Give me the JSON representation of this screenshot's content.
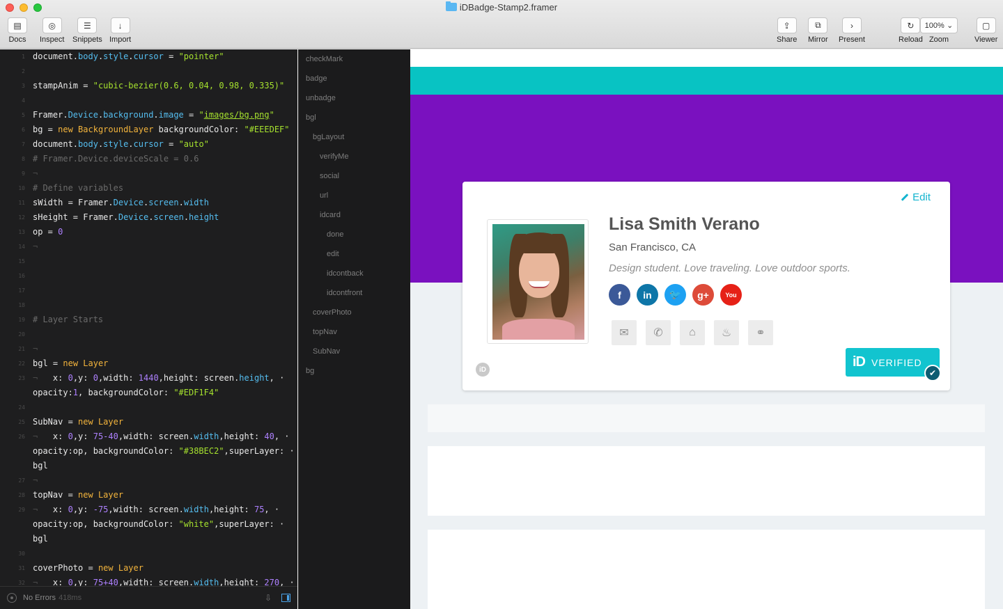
{
  "window": {
    "title": "iDBadge-Stamp2.framer"
  },
  "toolbar": {
    "left": [
      {
        "label": "Docs",
        "icon": "docs-icon",
        "glyph": "▤"
      },
      {
        "label": "Inspect",
        "icon": "inspect-icon",
        "glyph": "◎"
      },
      {
        "label": "Snippets",
        "icon": "snippets-icon",
        "glyph": "☰"
      },
      {
        "label": "Import",
        "icon": "import-icon",
        "glyph": "↓"
      }
    ],
    "right": [
      {
        "label": "Share",
        "icon": "share-icon",
        "glyph": "⇪"
      },
      {
        "label": "Mirror",
        "icon": "mirror-icon",
        "glyph": "⧉"
      },
      {
        "label": "Present",
        "icon": "present-icon",
        "glyph": "›"
      },
      {
        "label": "Reload",
        "icon": "reload-icon",
        "glyph": "↻"
      },
      {
        "label": "Zoom",
        "icon": "zoom-icon",
        "glyph": ""
      },
      {
        "label": "Viewer",
        "icon": "viewer-icon",
        "glyph": "▢"
      }
    ],
    "zoom_value": "100%"
  },
  "code": [
    {
      "n": "1",
      "tokens": [
        [
          "document.",
          ""
        ],
        [
          "body",
          "prop"
        ],
        [
          ".",
          ""
        ],
        [
          "style",
          "prop"
        ],
        [
          ".",
          ""
        ],
        [
          "cursor",
          "prop"
        ],
        [
          " = ",
          ""
        ],
        [
          "\"pointer\"",
          "str"
        ]
      ]
    },
    {
      "n": "2",
      "tokens": []
    },
    {
      "n": "3",
      "tokens": [
        [
          "stampAnim",
          ""
        ],
        [
          " = ",
          ""
        ],
        [
          "\"cubic-bezier(0.6, 0.04, 0.98, 0.335)\"",
          "str"
        ]
      ]
    },
    {
      "n": "4",
      "tokens": []
    },
    {
      "n": "5",
      "tokens": [
        [
          "Framer.",
          ""
        ],
        [
          "Device",
          "prop"
        ],
        [
          ".",
          ""
        ],
        [
          "background",
          "prop"
        ],
        [
          ".",
          ""
        ],
        [
          "image",
          "prop"
        ],
        [
          " = ",
          ""
        ],
        [
          "\"",
          "str"
        ],
        [
          "images/bg.png",
          "strlink"
        ],
        [
          "\"",
          "str"
        ]
      ]
    },
    {
      "n": "6",
      "tokens": [
        [
          "bg",
          ""
        ],
        [
          " = ",
          ""
        ],
        [
          "new ",
          "kw"
        ],
        [
          "BackgroundLayer",
          "kw"
        ],
        [
          " backgroundColor: ",
          ""
        ],
        [
          "\"#EEEDEF\"",
          "str"
        ]
      ]
    },
    {
      "n": "7",
      "tokens": [
        [
          "document.",
          ""
        ],
        [
          "body",
          "prop"
        ],
        [
          ".",
          ""
        ],
        [
          "style",
          "prop"
        ],
        [
          ".",
          ""
        ],
        [
          "cursor",
          "prop"
        ],
        [
          " = ",
          ""
        ],
        [
          "\"auto\"",
          "str"
        ]
      ]
    },
    {
      "n": "8",
      "tokens": [
        [
          "# Framer.Device.deviceScale = 0.6",
          "comment"
        ]
      ]
    },
    {
      "n": "9",
      "tokens": [
        [
          "¬",
          "dot"
        ]
      ]
    },
    {
      "n": "10",
      "tokens": [
        [
          "# Define variables",
          "comment"
        ]
      ]
    },
    {
      "n": "11",
      "tokens": [
        [
          "sWidth",
          ""
        ],
        [
          " = ",
          ""
        ],
        [
          "Framer",
          ""
        ],
        [
          ".",
          ""
        ],
        [
          "Device",
          "prop"
        ],
        [
          ".",
          ""
        ],
        [
          "screen",
          "prop"
        ],
        [
          ".",
          ""
        ],
        [
          "width",
          "prop"
        ]
      ]
    },
    {
      "n": "12",
      "tokens": [
        [
          "sHeight",
          ""
        ],
        [
          " = ",
          ""
        ],
        [
          "Framer",
          ""
        ],
        [
          ".",
          ""
        ],
        [
          "Device",
          "prop"
        ],
        [
          ".",
          ""
        ],
        [
          "screen",
          "prop"
        ],
        [
          ".",
          ""
        ],
        [
          "height",
          "prop"
        ]
      ]
    },
    {
      "n": "13",
      "tokens": [
        [
          "op",
          ""
        ],
        [
          " = ",
          ""
        ],
        [
          "0",
          "num"
        ]
      ]
    },
    {
      "n": "14",
      "tokens": [
        [
          "¬",
          "dot"
        ]
      ]
    },
    {
      "n": "15",
      "tokens": []
    },
    {
      "n": "16",
      "tokens": []
    },
    {
      "n": "17",
      "tokens": []
    },
    {
      "n": "18",
      "tokens": []
    },
    {
      "n": "19",
      "tokens": [
        [
          "# Layer Starts",
          "comment"
        ]
      ]
    },
    {
      "n": "20",
      "tokens": []
    },
    {
      "n": "21",
      "tokens": [
        [
          "¬",
          "dot"
        ]
      ]
    },
    {
      "n": "22",
      "tokens": [
        [
          "bgl",
          ""
        ],
        [
          " = ",
          ""
        ],
        [
          "new ",
          "kw"
        ],
        [
          "Layer",
          "kw"
        ]
      ]
    },
    {
      "n": "23",
      "tokens": [
        [
          "¬   ",
          "dot"
        ],
        [
          "x: ",
          ""
        ],
        [
          "0",
          "num"
        ],
        [
          ",y: ",
          ""
        ],
        [
          "0",
          "num"
        ],
        [
          ",width: ",
          ""
        ],
        [
          "1440",
          "num"
        ],
        [
          ",height: ",
          ""
        ],
        [
          "screen",
          ""
        ],
        [
          ".",
          ""
        ],
        [
          "height",
          "prop"
        ],
        [
          ", ·",
          ""
        ]
      ]
    },
    {
      "n": "",
      "tokens": [
        [
          "opacity:",
          ""
        ],
        [
          "1",
          "num"
        ],
        [
          ", backgroundColor: ",
          ""
        ],
        [
          "\"#EDF1F4\"",
          "str"
        ]
      ]
    },
    {
      "n": "24",
      "tokens": []
    },
    {
      "n": "25",
      "tokens": [
        [
          "SubNav",
          ""
        ],
        [
          " = ",
          ""
        ],
        [
          "new ",
          "kw"
        ],
        [
          "Layer",
          "kw"
        ]
      ]
    },
    {
      "n": "26",
      "tokens": [
        [
          "¬   ",
          "dot"
        ],
        [
          "x: ",
          ""
        ],
        [
          "0",
          "num"
        ],
        [
          ",y: ",
          ""
        ],
        [
          "75-40",
          "num"
        ],
        [
          ",width: ",
          ""
        ],
        [
          "screen",
          ""
        ],
        [
          ".",
          ""
        ],
        [
          "width",
          "prop"
        ],
        [
          ",height: ",
          ""
        ],
        [
          "40",
          "num"
        ],
        [
          ", ·",
          ""
        ]
      ]
    },
    {
      "n": "",
      "tokens": [
        [
          "opacity:op, backgroundColor: ",
          ""
        ],
        [
          "\"#38BEC2\"",
          "str"
        ],
        [
          ",superLayer: ·",
          ""
        ]
      ]
    },
    {
      "n": "",
      "tokens": [
        [
          "bgl",
          ""
        ]
      ]
    },
    {
      "n": "27",
      "tokens": [
        [
          "¬",
          "dot"
        ]
      ]
    },
    {
      "n": "28",
      "tokens": [
        [
          "topNav",
          ""
        ],
        [
          " = ",
          ""
        ],
        [
          "new ",
          "kw"
        ],
        [
          "Layer",
          "kw"
        ]
      ]
    },
    {
      "n": "29",
      "tokens": [
        [
          "¬   ",
          "dot"
        ],
        [
          "x: ",
          ""
        ],
        [
          "0",
          "num"
        ],
        [
          ",y: ",
          ""
        ],
        [
          "-75",
          "num"
        ],
        [
          ",width: ",
          ""
        ],
        [
          "screen",
          ""
        ],
        [
          ".",
          ""
        ],
        [
          "width",
          "prop"
        ],
        [
          ",height: ",
          ""
        ],
        [
          "75",
          "num"
        ],
        [
          ", ·",
          ""
        ]
      ]
    },
    {
      "n": "",
      "tokens": [
        [
          "opacity:op, backgroundColor: ",
          ""
        ],
        [
          "\"white\"",
          "str"
        ],
        [
          ",superLayer: ·",
          ""
        ]
      ]
    },
    {
      "n": "",
      "tokens": [
        [
          "bgl",
          ""
        ]
      ]
    },
    {
      "n": "30",
      "tokens": []
    },
    {
      "n": "31",
      "tokens": [
        [
          "coverPhoto",
          ""
        ],
        [
          " = ",
          ""
        ],
        [
          "new ",
          "kw"
        ],
        [
          "Layer",
          "kw"
        ]
      ]
    },
    {
      "n": "32",
      "tokens": [
        [
          "¬   ",
          "dot"
        ],
        [
          "x: ",
          ""
        ],
        [
          "0",
          "num"
        ],
        [
          ",y: ",
          ""
        ],
        [
          "75+40",
          "num"
        ],
        [
          ",width: ",
          ""
        ],
        [
          "screen",
          ""
        ],
        [
          ".",
          ""
        ],
        [
          "width",
          "prop"
        ],
        [
          ",height: ",
          ""
        ],
        [
          "270",
          "num"
        ],
        [
          ", ·",
          ""
        ]
      ]
    }
  ],
  "status": {
    "text": "No Errors",
    "ms": "418ms"
  },
  "layers": [
    {
      "label": "checkMark",
      "depth": 0
    },
    {
      "label": "badge",
      "depth": 0
    },
    {
      "label": "unbadge",
      "depth": 0
    },
    {
      "label": "bgl",
      "depth": 0
    },
    {
      "label": "bgLayout",
      "depth": 1
    },
    {
      "label": "verifyMe",
      "depth": 2
    },
    {
      "label": "social",
      "depth": 2
    },
    {
      "label": "url",
      "depth": 2
    },
    {
      "label": "idcard",
      "depth": 2
    },
    {
      "label": "done",
      "depth": 3
    },
    {
      "label": "edit",
      "depth": 3
    },
    {
      "label": "idcontback",
      "depth": 3
    },
    {
      "label": "idcontfront",
      "depth": 3
    },
    {
      "label": "coverPhoto",
      "depth": 1
    },
    {
      "label": "topNav",
      "depth": 1
    },
    {
      "label": "SubNav",
      "depth": 1
    },
    {
      "label": "bg",
      "depth": 0
    }
  ],
  "profile": {
    "edit_label": "Edit",
    "name": "Lisa Smith Verano",
    "location": "San Francisco, CA",
    "bio": "Design student. Love traveling. Love outdoor sports.",
    "social": [
      {
        "name": "facebook-icon",
        "glyph": "f",
        "color": "#3b5998"
      },
      {
        "name": "linkedin-icon",
        "glyph": "in",
        "color": "#0e76a8"
      },
      {
        "name": "twitter-icon",
        "glyph": "🐦",
        "color": "#1da1f2"
      },
      {
        "name": "google-plus-icon",
        "glyph": "g+",
        "color": "#dd4b39"
      },
      {
        "name": "youtube-icon",
        "glyph": "You",
        "color": "#e62117"
      }
    ],
    "contacts": [
      {
        "name": "email-icon",
        "glyph": "✉"
      },
      {
        "name": "phone-icon",
        "glyph": "✆"
      },
      {
        "name": "home-icon",
        "glyph": "⌂"
      },
      {
        "name": "birthday-cake-icon",
        "glyph": "♨"
      },
      {
        "name": "link-icon",
        "glyph": "⚭"
      }
    ],
    "verified_mark": "iD",
    "verified_label": "VERIFIED",
    "small_logo": "iD"
  },
  "colors": {
    "subnav": "#08c3c3",
    "cover": "#7a11bf",
    "accent": "#13b4cf"
  }
}
